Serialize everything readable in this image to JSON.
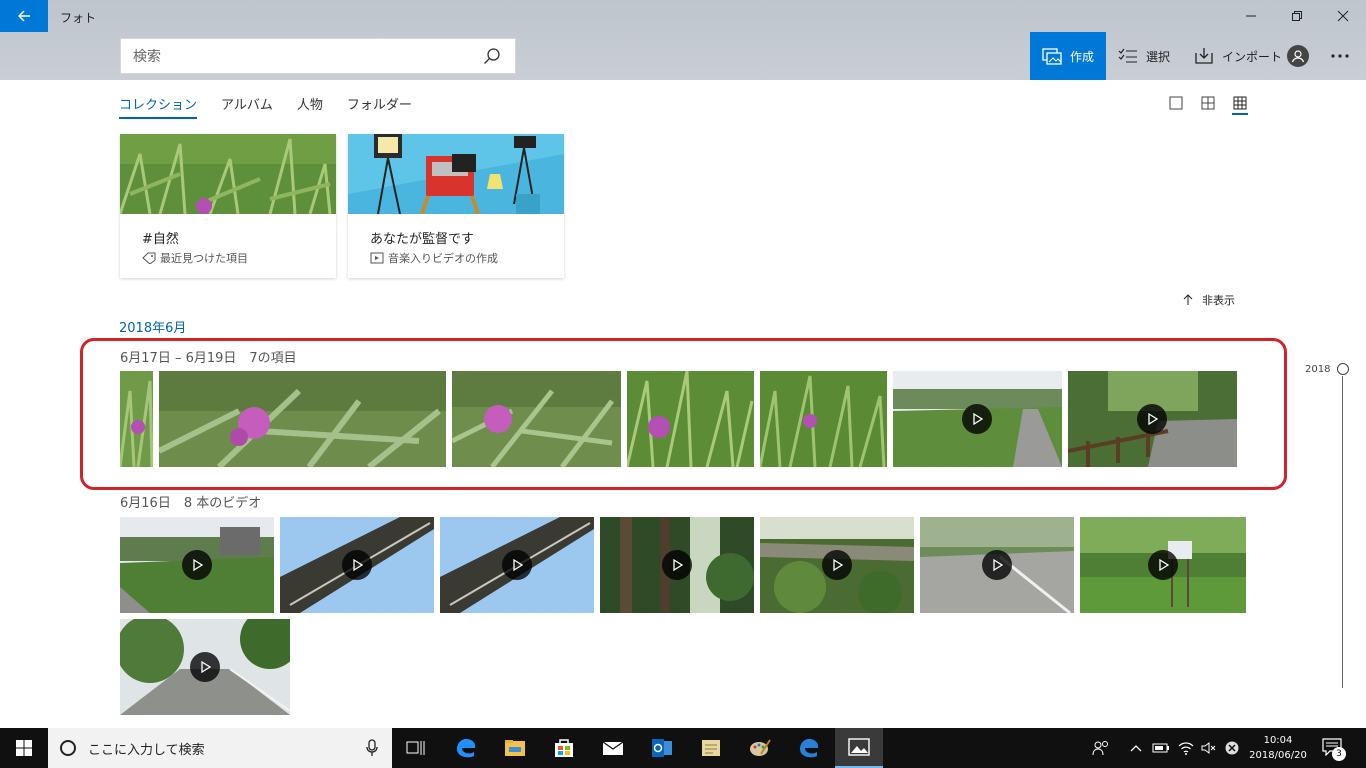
{
  "window": {
    "title": "フォト"
  },
  "search": {
    "placeholder": "検索"
  },
  "commands": {
    "create": "作成",
    "select": "選択",
    "import": "インポート"
  },
  "tabs": [
    {
      "label": "コレクション",
      "active": true
    },
    {
      "label": "アルバム",
      "active": false
    },
    {
      "label": "人物",
      "active": false
    },
    {
      "label": "フォルダー",
      "active": false
    }
  ],
  "cards": [
    {
      "title": "#自然",
      "subtitle": "最近見つけた項目",
      "icon": "tag-icon"
    },
    {
      "title": "あなたが監督です",
      "subtitle": "音楽入りビデオの作成",
      "icon": "video-icon"
    }
  ],
  "hide_label": "非表示",
  "month_heading": "2018年6月",
  "groups": [
    {
      "label": "6月17日 – 6月19日　7の項目"
    },
    {
      "label": "6月16日　8 本のビデオ"
    }
  ],
  "timeline": {
    "year": "2018"
  },
  "taskbar": {
    "search_placeholder": "ここに入力して検索",
    "time": "10:04",
    "date": "2018/06/20",
    "notification_count": "3"
  },
  "colors": {
    "accent": "#0078d7",
    "highlight": "#d0232a"
  }
}
